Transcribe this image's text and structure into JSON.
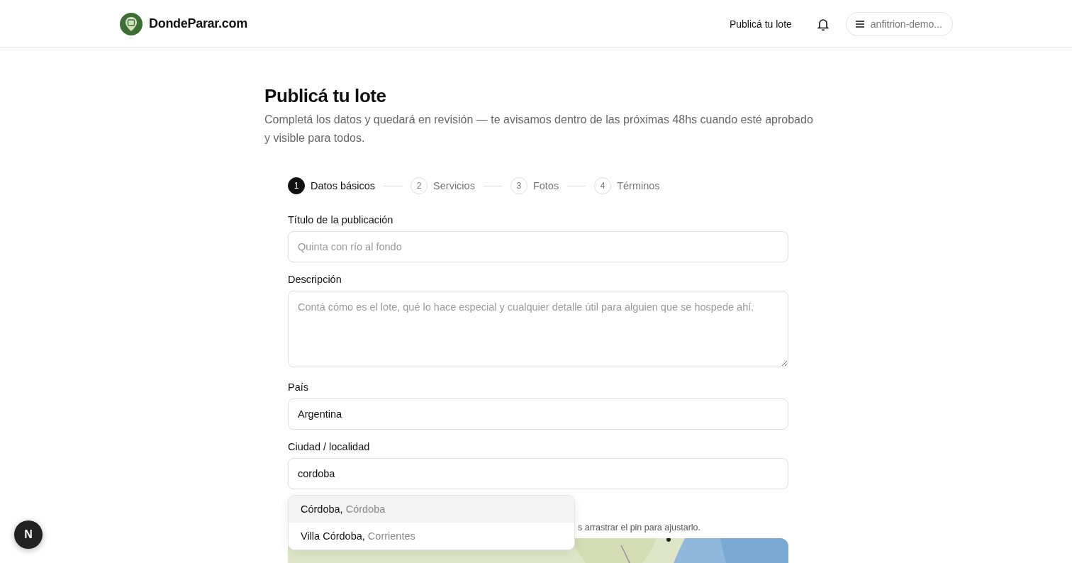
{
  "header": {
    "brand": "DondeParar.com",
    "nav_link": "Publicá tu lote",
    "user_menu": "anfitrion-demo..."
  },
  "page": {
    "title": "Publicá tu lote",
    "subtitle": "Completá los datos y quedará en revisión — te avisamos dentro de las próximas 48hs cuando esté aprobado y visible para todos."
  },
  "steps": [
    {
      "number": "1",
      "label": "Datos básicos",
      "selected": true
    },
    {
      "number": "2",
      "label": "Servicios",
      "selected": false
    },
    {
      "number": "3",
      "label": "Fotos",
      "selected": false
    },
    {
      "number": "4",
      "label": "Términos",
      "selected": false
    }
  ],
  "fields": [
    {
      "kind": "input",
      "label": "Título de la publicación",
      "placeholder": "Quinta con río al fondo"
    },
    {
      "kind": "textarea",
      "label": "Descripción",
      "placeholder": "Contá cómo es el lote, qué lo hace especial y cualquier detalle útil para alguien que se hospede ahí."
    },
    {
      "kind": "input",
      "label": "País",
      "value": "Argentina"
    },
    {
      "kind": "input",
      "label": "Ciudad / localidad",
      "value": "cordoba"
    }
  ],
  "suggestions": [
    {
      "city": "Córdoba,",
      "province": "Córdoba",
      "selected": true
    },
    {
      "city": "Villa Córdoba,",
      "province": "Corrientes",
      "selected": false
    }
  ],
  "map_hint": "s arrastrar el pin para ajustarlo.",
  "dev_badge": "N"
}
